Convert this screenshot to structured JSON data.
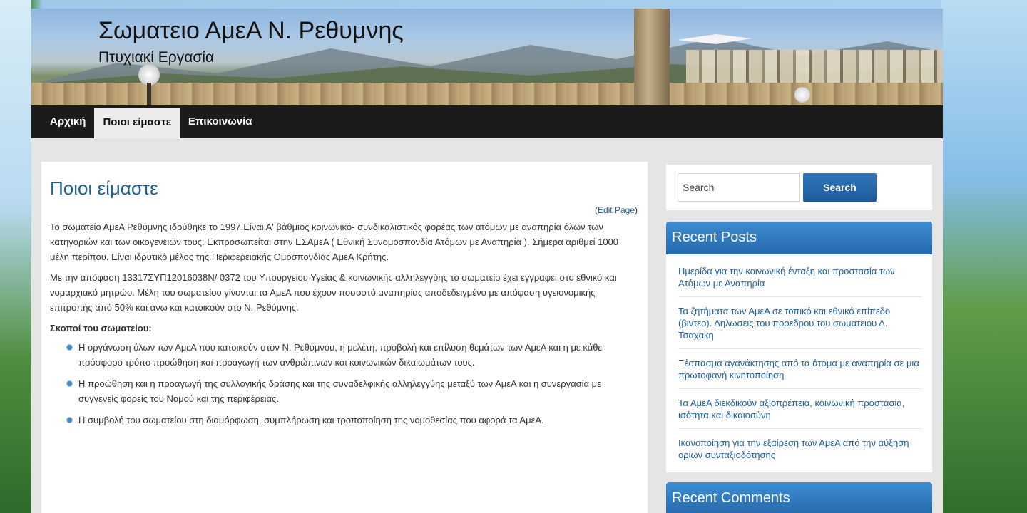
{
  "header": {
    "site_title": "Σωματειο ΑμεΑ Ν. Ρεθυμνης",
    "site_subtitle": "Πτυχιακί Εργασία"
  },
  "nav": {
    "items": [
      {
        "label": "Αρχική",
        "active": false
      },
      {
        "label": "Ποιοι είμαστε",
        "active": true
      },
      {
        "label": "Επικοινωνία",
        "active": false
      }
    ]
  },
  "main": {
    "title": "Ποιοι είμαστε",
    "edit_open": "(",
    "edit_link": "Edit Page",
    "edit_close": ")",
    "paragraphs": [
      "Το σωματείο ΑμεΑ Ρεθύμνης ιδρύθηκε το 1997.Είναι Α' βάθμιος κοινωνικό- συνδικαλιστικός φορέας των ατόμων με αναπηρία όλων των κατηγοριών και των οικογενειών τους. Εκπροσωπείται στην ΕΣΑμεΑ ( Εθνική Συνομοσπονδία Ατόμων με Αναπηρία ). Σήμερα αριθμεί 1000 μέλη περίπου. Είναι ιδρυτικό μέλος της Περιφερειακής Ομοσπονδίας ΑμεΑ Κρήτης.",
      "Με την απόφαση 13317ΣΥΠ12016038Ν/ 0372 του Υπουργείου Υγείας & κοινωνικής αλληλεγγύης το σωματείο έχει εγγραφεί στο εθνικό και νομαρχιακό μητρώο. Μέλη του σωματείου γίνονται τα ΑμεΑ που έχουν ποσοστό αναπηρίας αποδεδειγμένο με απόφαση υγειονομικής επιτροπής από 50% και άνω και κατοικούν στο Ν. Ρεθύμνης."
    ],
    "goals_heading": "Σκοποί του σωματείου:",
    "goals": [
      "Η οργάνωση όλων των ΑμεΑ που κατοικούν στον Ν. Ρεθύμνου, η μελέτη, προβολή και επίλυση θεμάτων των ΑμεΑ και η με κάθε πρόσφορο τρόπο προώθηση και προαγωγή των ανθρώπινων και κοινωνικών δικαιωμάτων τους.",
      "Η προώθηση και η προαγωγή της συλλογικής δράσης και της συναδελφικής αλληλεγγύης μεταξύ των ΑμεΑ και η συνεργασία με συγγενείς φορείς του Νομού και της περιφέρειας.",
      "Η συμβολή του σωματείου στη διαμόρφωση, συμπλήρωση και τροποποίηση της νομοθεσίας που αφορά τα ΑμεΑ."
    ]
  },
  "sidebar": {
    "search": {
      "placeholder": "Search",
      "button_label": "Search"
    },
    "recent_posts": {
      "title": "Recent Posts",
      "items": [
        "Ημερίδα για την κοινωνική ένταξη και προστασία των Ατόμων με Αναπηρία",
        "Τα ζητήματα των ΑμεΑ σε τοπικό και εθνικό επίπεδο (βιντεο). Δηλωσεις του προεδρου του σωματειου Δ. Τσαχακη",
        "Ξέσπασμα αγανάκτησης από τα άτομα με αναπηρία σε μια πρωτοφανή κινητοποίηση",
        "Τα ΑμεΑ διεκδικούν αξιοπρέπεια, κοινωνική προστασία, ισότητα και δικαιοσύνη",
        "Ικανοποίηση για την εξαίρεση των ΑμεΑ από την αύξηση ορίων συνταξιοδότησης"
      ]
    },
    "recent_comments": {
      "title": "Recent Comments"
    }
  },
  "colors": {
    "accent": "#1f5f8f",
    "nav_bg": "#1b1b1b",
    "widget_title_bg": "#2f7bc0"
  }
}
